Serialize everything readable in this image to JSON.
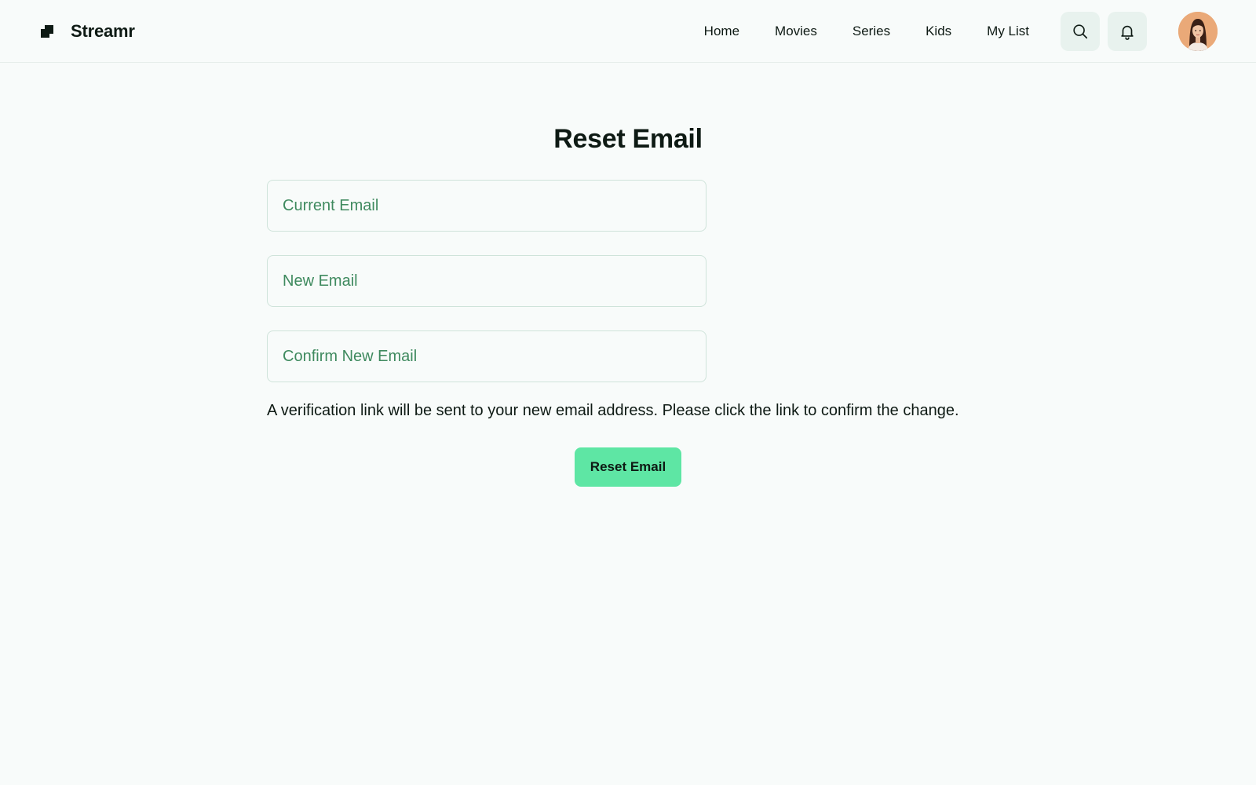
{
  "header": {
    "brand": {
      "name": "Streamr",
      "logo_icon": "streamr-logo-icon"
    },
    "nav": [
      {
        "label": "Home"
      },
      {
        "label": "Movies"
      },
      {
        "label": "Series"
      },
      {
        "label": "Kids"
      },
      {
        "label": "My List"
      }
    ],
    "search_icon": "search-icon",
    "notifications_icon": "bell-icon",
    "avatar_icon": "user-avatar"
  },
  "main": {
    "title": "Reset Email",
    "fields": {
      "current_email": {
        "placeholder": "Current Email",
        "value": ""
      },
      "new_email": {
        "placeholder": "New Email",
        "value": ""
      },
      "confirm_email": {
        "placeholder": "Confirm New Email",
        "value": ""
      }
    },
    "helper_text": "A verification link will be sent to your new email address. Please click the link to confirm the change.",
    "submit_label": "Reset Email"
  },
  "colors": {
    "accent": "#5ee6a4",
    "placeholder": "#3f8a5f",
    "icon_button_bg": "#e8f2ee",
    "page_bg": "#f8fbfa",
    "text": "#0e1a14"
  }
}
